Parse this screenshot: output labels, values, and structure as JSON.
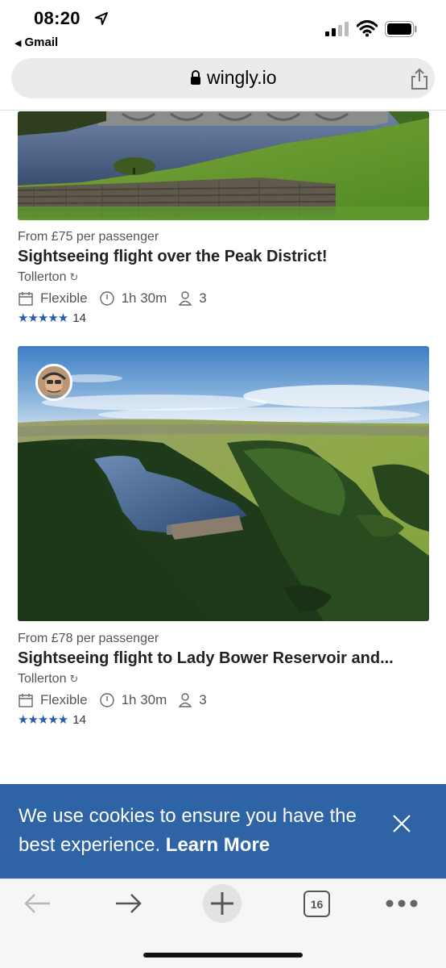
{
  "status": {
    "time": "08:20",
    "back_app": "Gmail"
  },
  "browser": {
    "url": "wingly.io",
    "tab_count": "16"
  },
  "listings": [
    {
      "price": "From £75 per passenger",
      "title": "Sightseeing flight over the Peak District!",
      "location": "Tollerton",
      "date": "Flexible",
      "duration": "1h 30m",
      "seats": "3",
      "stars": "★★★★★",
      "reviews": "14"
    },
    {
      "price": "From £78 per passenger",
      "title": "Sightseeing flight to Lady Bower Reservoir and...",
      "location": "Tollerton",
      "date": "Flexible",
      "duration": "1h 30m",
      "seats": "3",
      "stars": "★★★★★",
      "reviews": "14"
    }
  ],
  "cookie": {
    "text": "We use cookies to ensure you have the best experience.",
    "link": "Learn More"
  },
  "icons": {
    "location": "location-arrow-icon",
    "lock": "lock-icon",
    "share": "share-icon",
    "refresh": "refresh-icon",
    "calendar": "calendar-icon",
    "clock": "clock-icon",
    "person": "person-icon",
    "close": "close-icon"
  },
  "colors": {
    "accent": "#2e63a6",
    "stars": "#2a5ea8"
  }
}
